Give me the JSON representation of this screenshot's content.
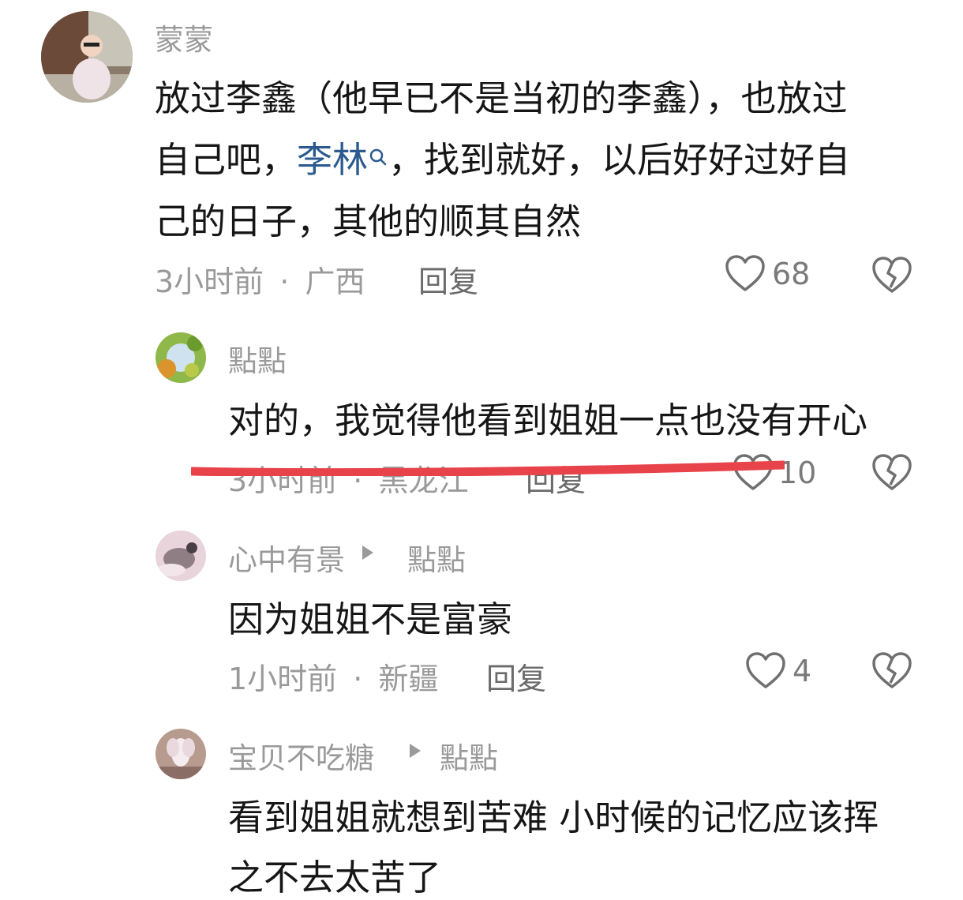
{
  "comments": [
    {
      "username": "蒙蒙",
      "text_lines": [
        "放过李鑫（他早已不是当初的李鑫），也放过",
        "自己吧，",
        "，找到就好，以后好好过好自",
        "己的日子，其他的顺其自然"
      ],
      "mention_link": "李林",
      "time": "3小时前",
      "separator": "·",
      "location": "广西",
      "reply_label": "回复",
      "likes": "68",
      "avatar_icon": "child-photo-avatar"
    },
    {
      "username": "點點",
      "text": "对的，我觉得他看到姐姐一点也没有开心",
      "time": "3小时前",
      "separator": "·",
      "location": "黑龙江",
      "reply_label": "回复",
      "likes": "10",
      "avatar_icon": "tree-canopy-avatar"
    },
    {
      "username": "心中有景",
      "reply_to": "點點",
      "text": "因为姐姐不是富豪",
      "time": "1小时前",
      "separator": "·",
      "location": "新疆",
      "reply_label": "回复",
      "likes": "4",
      "avatar_icon": "landscape-avatar"
    },
    {
      "username": "宝贝不吃糖",
      "reply_to": "點點",
      "text_lines": [
        "看到姐姐就想到苦难 小时候的记忆应该挥",
        "之不去太苦了"
      ],
      "avatar_icon": "flower-avatar"
    }
  ],
  "colors": {
    "strike_line": "#e8434a",
    "muted_text": "#9a9a9a",
    "link": "#2c5a8f"
  },
  "icons": [
    "heart-outline-icon",
    "broken-heart-icon",
    "search-icon",
    "reply-arrow-icon"
  ]
}
